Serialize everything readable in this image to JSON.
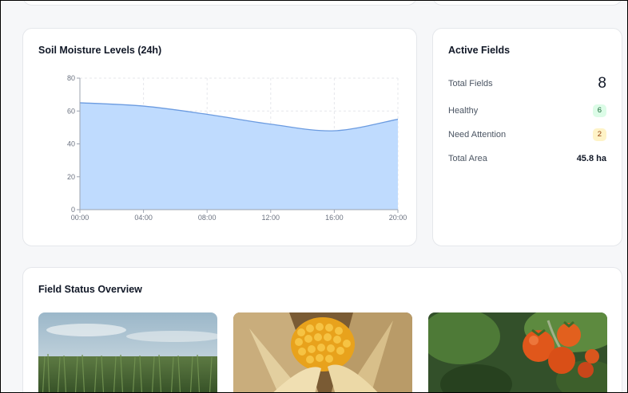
{
  "moisture": {
    "title": "Soil Moisture Levels (24h)"
  },
  "chart_data": {
    "type": "area",
    "title": "Soil Moisture Levels (24h)",
    "x": [
      "00:00",
      "04:00",
      "08:00",
      "12:00",
      "16:00",
      "20:00"
    ],
    "y_ticks": [
      0,
      20,
      40,
      60,
      80
    ],
    "ylim": [
      0,
      80
    ],
    "series": [
      {
        "values": [
          65,
          63,
          58,
          52,
          48,
          55
        ]
      }
    ],
    "grid": true,
    "color": "#bfdbfe",
    "line_color": "#6b9be0"
  },
  "active_fields": {
    "title": "Active Fields",
    "rows": [
      {
        "label": "Total Fields",
        "value": "8"
      },
      {
        "label": "Healthy",
        "value": "6"
      },
      {
        "label": "Need Attention",
        "value": "2"
      },
      {
        "label": "Total Area",
        "value": "45.8 ha"
      }
    ]
  },
  "field_status": {
    "title": "Field Status Overview",
    "images": [
      "wheat-field-photo",
      "corn-photo",
      "tomato-photo"
    ]
  }
}
